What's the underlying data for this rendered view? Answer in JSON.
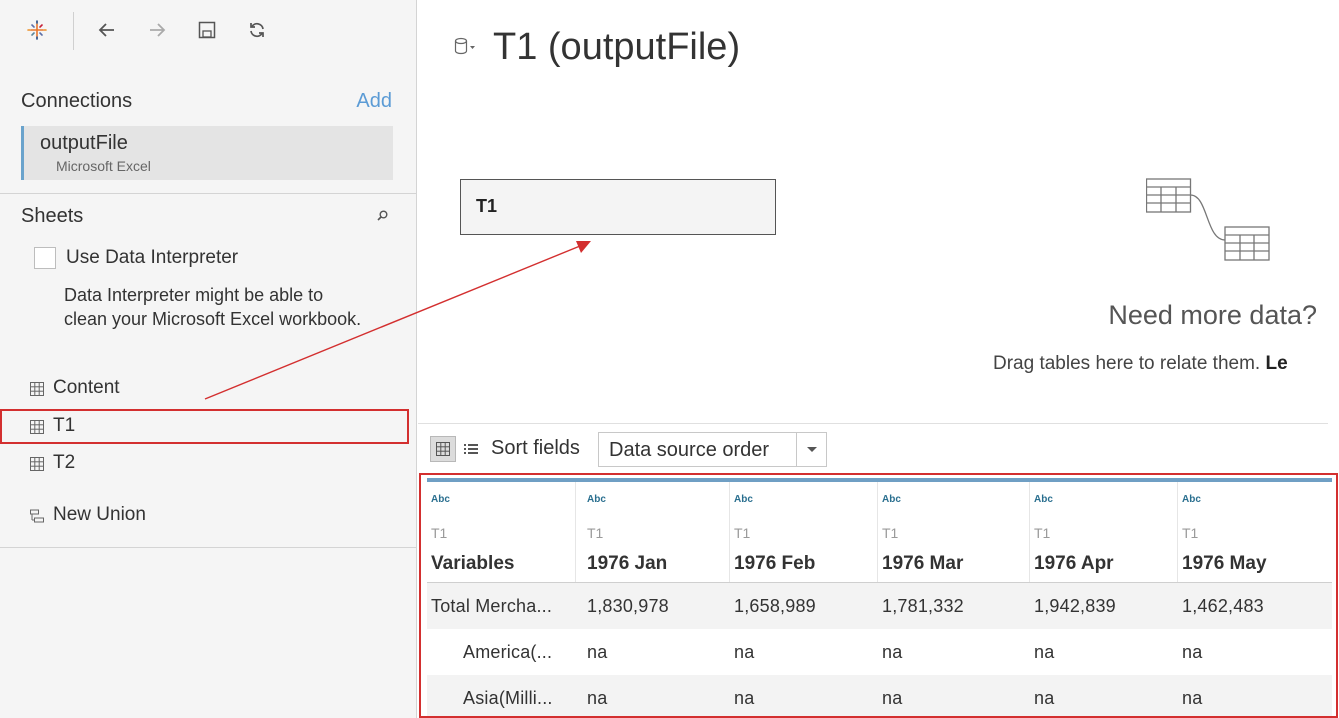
{
  "toolbar": {
    "icons": [
      "tableau-logo-icon",
      "back-arrow-icon",
      "forward-arrow-icon",
      "save-icon",
      "refresh-icon"
    ]
  },
  "connections": {
    "heading": "Connections",
    "add_label": "Add",
    "items": [
      {
        "name": "outputFile",
        "type": "Microsoft Excel"
      }
    ]
  },
  "sheets": {
    "heading": "Sheets",
    "use_interpreter_label": "Use Data Interpreter",
    "interpreter_desc": "Data Interpreter might be able to clean your Microsoft Excel workbook.",
    "items": [
      {
        "label": "Content"
      },
      {
        "label": "T1"
      },
      {
        "label": "T2"
      }
    ],
    "new_union_label": "New Union"
  },
  "main": {
    "title": "T1 (outputFile)",
    "canvas_table": "T1",
    "need_more": "Need more data?",
    "drag_hint": "Drag tables here to relate them.",
    "drag_hint_bold": "Le"
  },
  "grid_controls": {
    "sort_label": "Sort fields",
    "sort_value": "Data source order"
  },
  "grid": {
    "columns": [
      {
        "type": "Abc",
        "source": "T1",
        "name": "Variables"
      },
      {
        "type": "Abc",
        "source": "T1",
        "name": "1976 Jan"
      },
      {
        "type": "Abc",
        "source": "T1",
        "name": "1976 Feb"
      },
      {
        "type": "Abc",
        "source": "T1",
        "name": "1976 Mar"
      },
      {
        "type": "Abc",
        "source": "T1",
        "name": "1976 Apr"
      },
      {
        "type": "Abc",
        "source": "T1",
        "name": "1976 May"
      }
    ],
    "rows": [
      [
        "Total Mercha...",
        "1,830,978",
        "1,658,989",
        "1,781,332",
        "1,942,839",
        "1,462,483"
      ],
      [
        "America(...",
        "na",
        "na",
        "na",
        "na",
        "na"
      ],
      [
        "Asia(Milli...",
        "na",
        "na",
        "na",
        "na",
        "na"
      ]
    ]
  },
  "colors": {
    "accent": "#5b9bd5",
    "selection_outline": "#d32f2f",
    "annotation_arrow": "#d32f2f",
    "header_bar": "#6f9fc4"
  }
}
